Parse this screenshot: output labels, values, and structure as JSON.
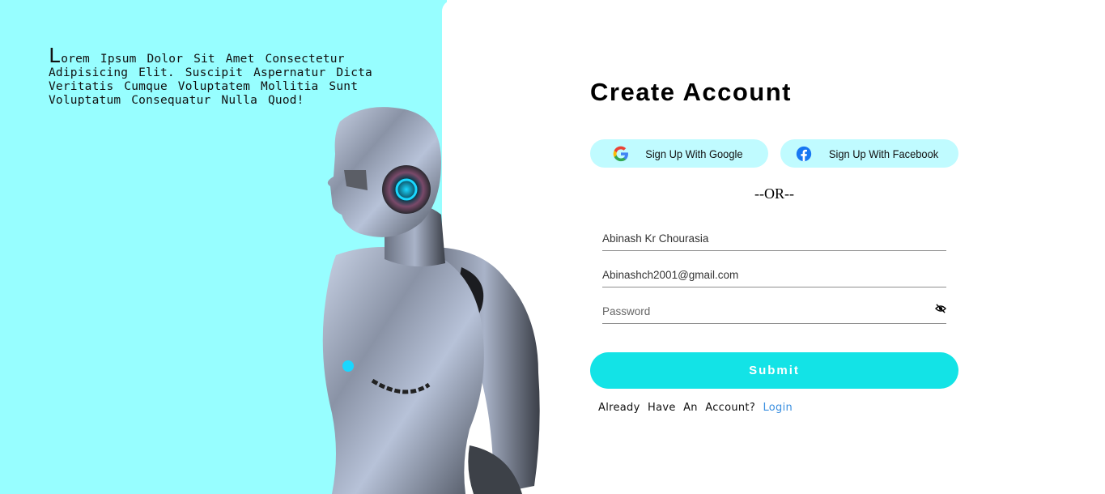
{
  "intro": {
    "first_letter": "L",
    "text": "orem Ipsum Dolor Sit Amet Consectetur Adipisicing Elit. Suscipit Aspernatur Dicta Veritatis Cumque Voluptatem Mollitia Sunt Voluptatum Consequatur Nulla Quod!"
  },
  "form": {
    "title": "Create Account",
    "google_label": "Sign Up With Google",
    "facebook_label": "Sign Up With Facebook",
    "or_text": "--OR--",
    "name_value": "Abinash Kr Chourasia",
    "email_value": "Abinashch2001@gmail.com",
    "password_placeholder": "Password",
    "submit_label": "Submit",
    "login_prompt": "Already Have An Account?",
    "login_link": "Login"
  },
  "colors": {
    "left_panel_bg": "#97feff",
    "social_button_bg": "#c0fbff",
    "submit_bg": "#13e3e6",
    "link": "#3a8fe0"
  },
  "icons": {
    "google": "google-icon",
    "facebook": "facebook-icon",
    "password_toggle": "eye-slash-icon"
  }
}
